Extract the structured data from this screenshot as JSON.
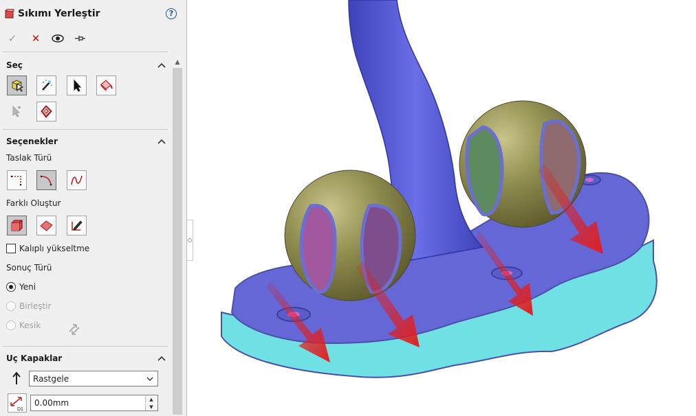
{
  "panel": {
    "title": "Sıkımı Yerleştir",
    "help": "?",
    "actions": {
      "ok": "✓",
      "cancel": "✕"
    },
    "groups": {
      "select": {
        "title": "Seç"
      },
      "options": {
        "title": "Seçenekler",
        "sketch_type_label": "Taslak Türü",
        "create_as_label": "Farklı Oluştur",
        "molded_rise_label": "Kalıplı yükseltme",
        "result_type_label": "Sonuç Türü",
        "radio_new": "Yeni",
        "radio_merge": "Birleştir",
        "radio_cut": "Kesik"
      },
      "end_caps": {
        "title": "Uç Kapaklar",
        "direction_value": "Rastgele",
        "thickness_value": "0.00mm"
      }
    }
  },
  "colors": {
    "ribbon": "#5a5fd6",
    "base_top": "#6567d6",
    "base_side": "#6fe0e4",
    "sphere": "#8e8b4e",
    "arrow": "#e01f1f"
  }
}
